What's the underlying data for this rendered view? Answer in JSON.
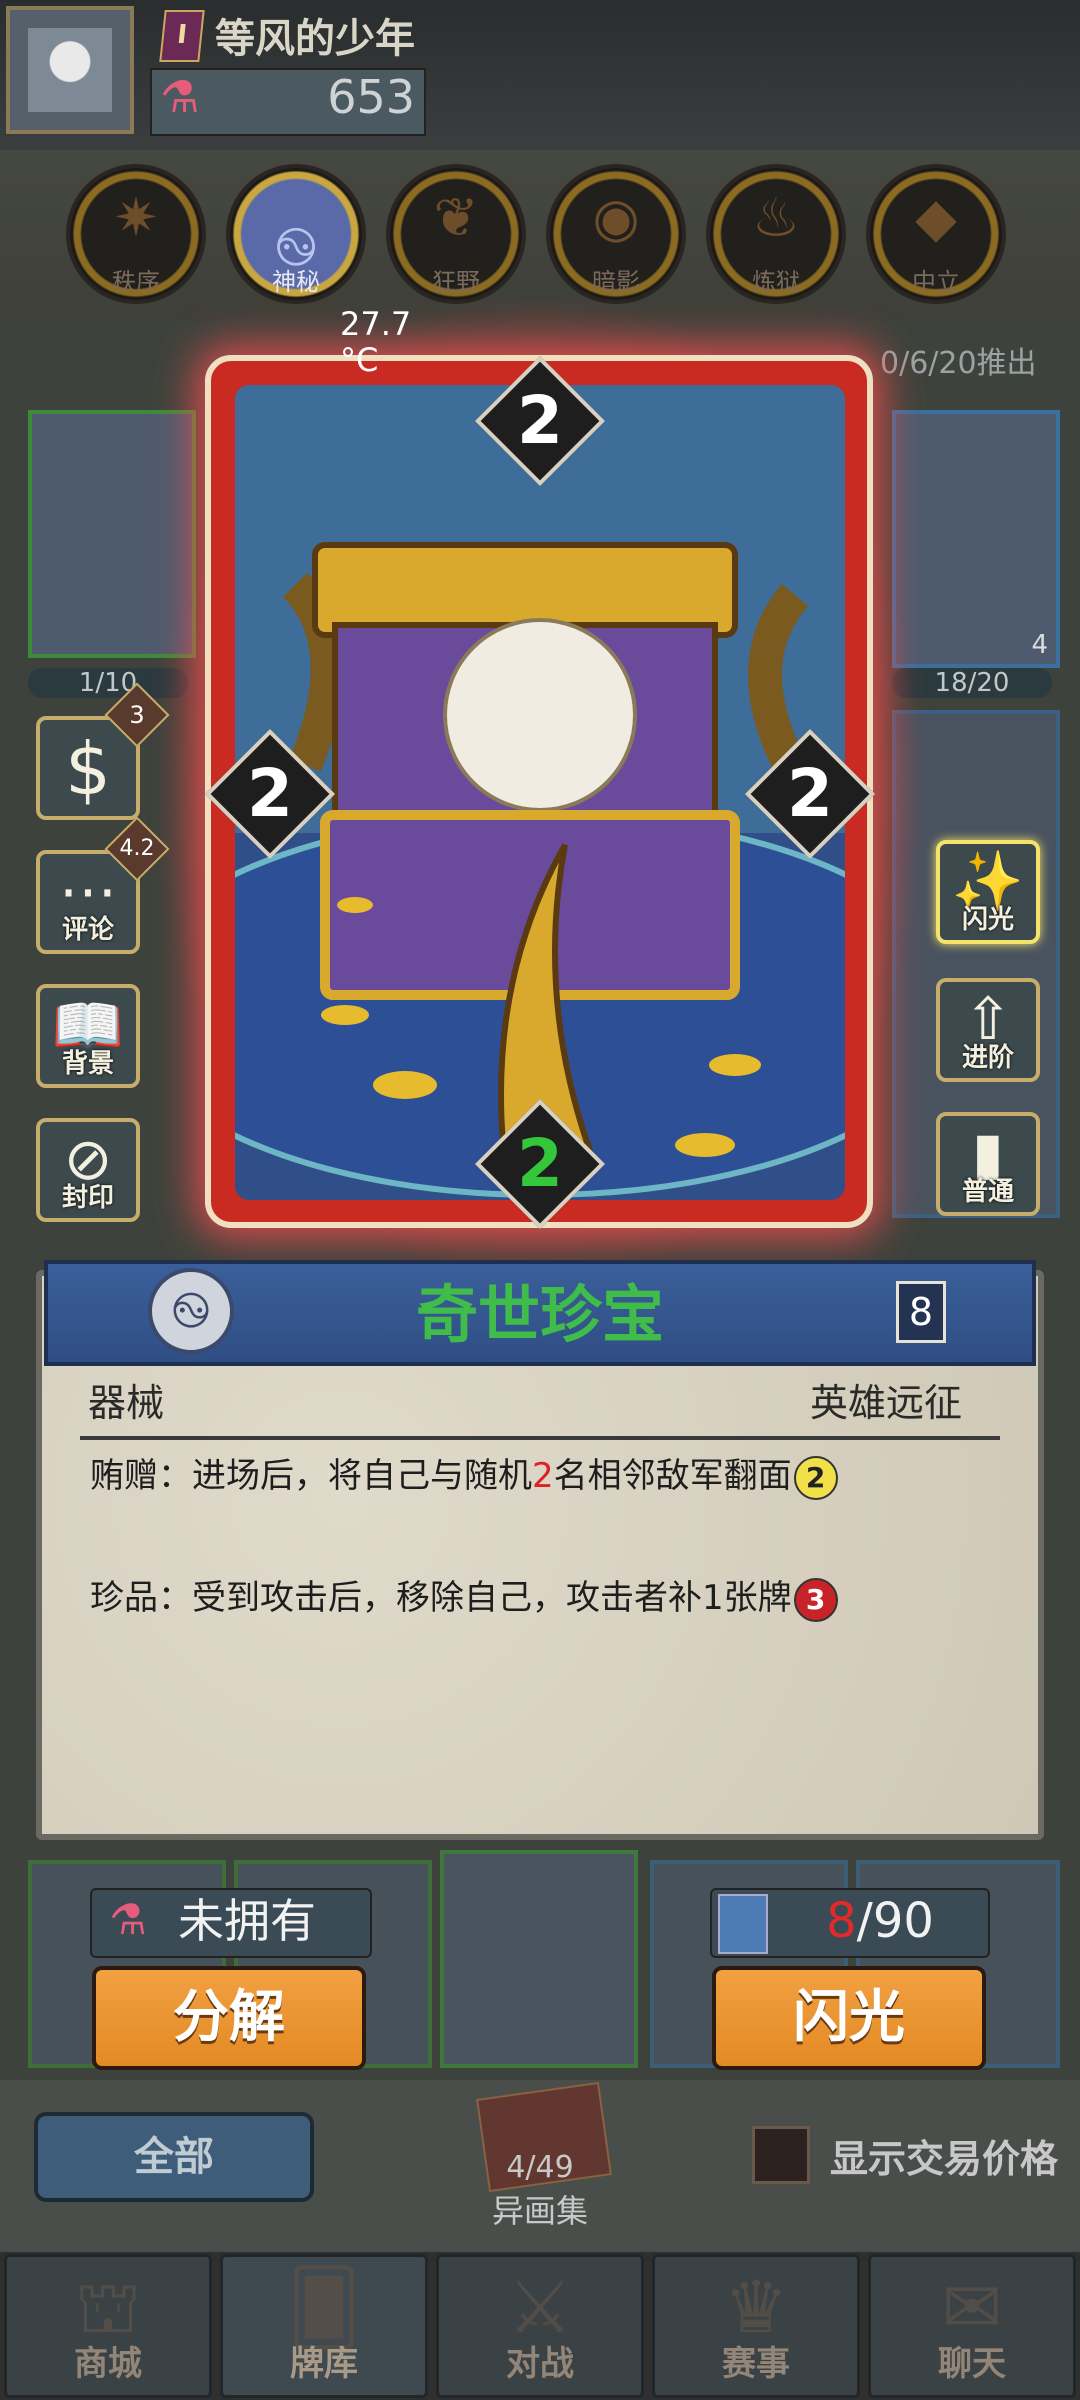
{
  "header": {
    "rank": "I",
    "username": "等风的少年",
    "potion_count": "653"
  },
  "factions": [
    {
      "label": "秩序",
      "icon": "sun-icon"
    },
    {
      "label": "神秘",
      "icon": "swirl-icon"
    },
    {
      "label": "狂野",
      "icon": "leaf-icon"
    },
    {
      "label": "暗影",
      "icon": "eye-icon"
    },
    {
      "label": "炼狱",
      "icon": "flame-icon"
    },
    {
      "label": "中立",
      "icon": "crystal-icon"
    }
  ],
  "status": {
    "temperature": "27.7\n°C",
    "date": "0/6/20推出"
  },
  "background_cards": {
    "progress_left": "1/10",
    "progress_right": "18/20",
    "corner_count": "4"
  },
  "side_buttons": {
    "price_badge": "3",
    "rating_badge": "4.2",
    "comment": "评论",
    "background": "背景",
    "seal": "封印",
    "flash": "闪光",
    "advance": "进阶",
    "normal": "普通"
  },
  "card": {
    "top_stat": "2",
    "left_stat": "2",
    "right_stat": "2",
    "bottom_stat": "2",
    "name": "奇世珍宝",
    "cost": "8",
    "type": "器械",
    "set": "英雄远征",
    "ability_1_prefix": "贿赠：进场后，将自己与随机",
    "ability_1_number": "2",
    "ability_1_suffix": "名相邻敌军翻面",
    "ability_1_tag": "2",
    "ability_2_text": "珍品：受到攻击后，移除自己，攻击者补1张牌",
    "ability_2_tag": "3",
    "colors": {
      "frame": "#c92a22",
      "name": "#3fbc4a"
    }
  },
  "actions": {
    "owned_status": "未拥有",
    "flash_current": "8",
    "flash_total": "/90",
    "decompose": "分解",
    "flash": "闪光"
  },
  "filter": {
    "all": "全部",
    "gallery_count": "4/49",
    "gallery_label": "异画集",
    "show_trade_price": "显示交易价格"
  },
  "nav": [
    {
      "label": "商城",
      "icon": "shop-icon"
    },
    {
      "label": "牌库",
      "icon": "deck-icon"
    },
    {
      "label": "对战",
      "icon": "battle-icon"
    },
    {
      "label": "赛事",
      "icon": "trophy-icon"
    },
    {
      "label": "聊天",
      "icon": "chat-icon"
    }
  ]
}
